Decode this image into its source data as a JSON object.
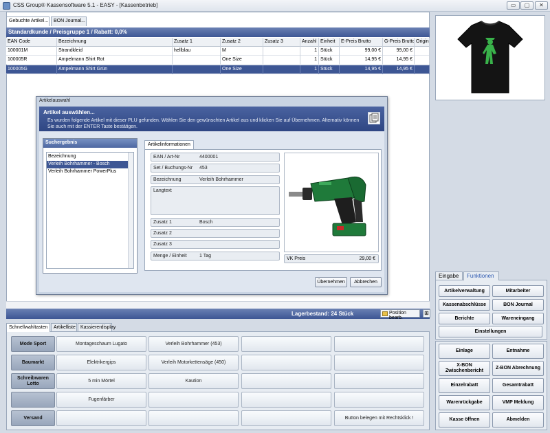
{
  "window": {
    "title": "CSS Group® Kassensoftware 5.1 - EASY - [Kassenbetrieb]",
    "btn_min": "▭",
    "btn_max": "▢",
    "btn_close": "✕"
  },
  "top_tabs": [
    "Gebuchte Artikel...",
    "BON Journal..."
  ],
  "customer_strip": "Standardkunde / Preisgruppe 1 / Rabatt: 0,0%",
  "grid": {
    "columns": [
      "EAN Code",
      "Bezeichnung",
      "Zusatz 1",
      "Zusatz 2",
      "Zusatz 3",
      "Anzahl",
      "Einheit",
      "E-Preis Brutto",
      "G-Preis Brutto",
      "Original"
    ],
    "rows": [
      [
        "100001M",
        "Strandkleid",
        "hellblau",
        "M",
        "",
        "1",
        "Stück",
        "99,00 €",
        "99,00 €",
        ""
      ],
      [
        "100005R",
        "Ampelmann Shirt Rot",
        "",
        "One Size",
        "",
        "1",
        "Stück",
        "14,95 €",
        "14,95 €",
        ""
      ],
      [
        "100005G",
        "Ampelmann Shirt Grün",
        "",
        "One Size",
        "",
        "1",
        "Stück",
        "14,95 €",
        "14,95 €",
        ""
      ]
    ]
  },
  "status": {
    "stock": "Lagerbestand: 24 Stück",
    "position_btn": "Position bearb.",
    "grid_btn": "⊞"
  },
  "dialog": {
    "title": "Artikelauswahl",
    "heading": "Artikel auswählen...",
    "description": "Es wurden folgende Artikel mit dieser PLU gefunden. Wählen Sie den gewünschten Artikel aus und klicken Sie auf Übernehmen. Alternativ können Sie auch mit der ENTER Taste bestätigen.",
    "search_title": "Suchergebnis",
    "search_items": [
      "Bezeichnung",
      "Verleih Bohrhammer - Bosch",
      "Verleih Bohrhammer PowerPlus"
    ],
    "info_tab": "Artikelinformationen",
    "fields": {
      "ean_label": "EAN / Art-Nr",
      "ean_value": "4400001",
      "set_label": "Set / Buchungs-Nr",
      "set_value": "453",
      "name_label": "Bezeichnung",
      "name_value": "Verleih Bohrhammer",
      "long_label": "Langtext",
      "long_value": "",
      "z1_label": "Zusatz 1",
      "z1_value": "Bosch",
      "z2_label": "Zusatz 2",
      "z2_value": "",
      "z3_label": "Zusatz 3",
      "z3_value": "",
      "qty_label": "Menge / Einheit",
      "qty_value": "1 Tag",
      "vk_label": "VK Preis",
      "vk_value": "29,00 €"
    },
    "btn_ok": "Übernehmen",
    "btn_cancel": "Abbrechen"
  },
  "bottom_tabs": [
    "Schnellwahltasten",
    "Artikelliste",
    "Kassiererdisplay"
  ],
  "quick": {
    "categories": [
      "Mode Sport",
      "Baumarkt",
      "Schreibwaren Lotto",
      "",
      "Versand"
    ],
    "rows": [
      [
        "Montageschaum Lugato",
        "Verleih Bohrhammer (453)",
        "",
        ""
      ],
      [
        "Elektrikergips",
        "Verleih Motorkettensäge (450)",
        "",
        ""
      ],
      [
        "5 min Mörtel",
        "Kaution",
        "",
        ""
      ],
      [
        "Fugenfärber",
        "",
        "",
        ""
      ],
      [
        "",
        "",
        "",
        "Button belegen mit Rechtsklick !"
      ]
    ]
  },
  "fn_tabs": [
    "Eingabe",
    "Funktionen"
  ],
  "fn_buttons_top": [
    "Artikelverwaltung",
    "Mitarbeiter",
    "Kassenabschlüsse",
    "BON Journal",
    "Berichte",
    "Wareneingang",
    "Einstellungen"
  ],
  "fn_buttons_bottom": [
    "Einlage",
    "Entnahme",
    "X-BON Zwischenbericht",
    "Z-BON Abrechnung",
    "Einzelrabatt",
    "Gesamtrabatt",
    "Warenrückgabe",
    "VMP Meldung",
    "Kasse öffnen",
    "Abmelden"
  ]
}
